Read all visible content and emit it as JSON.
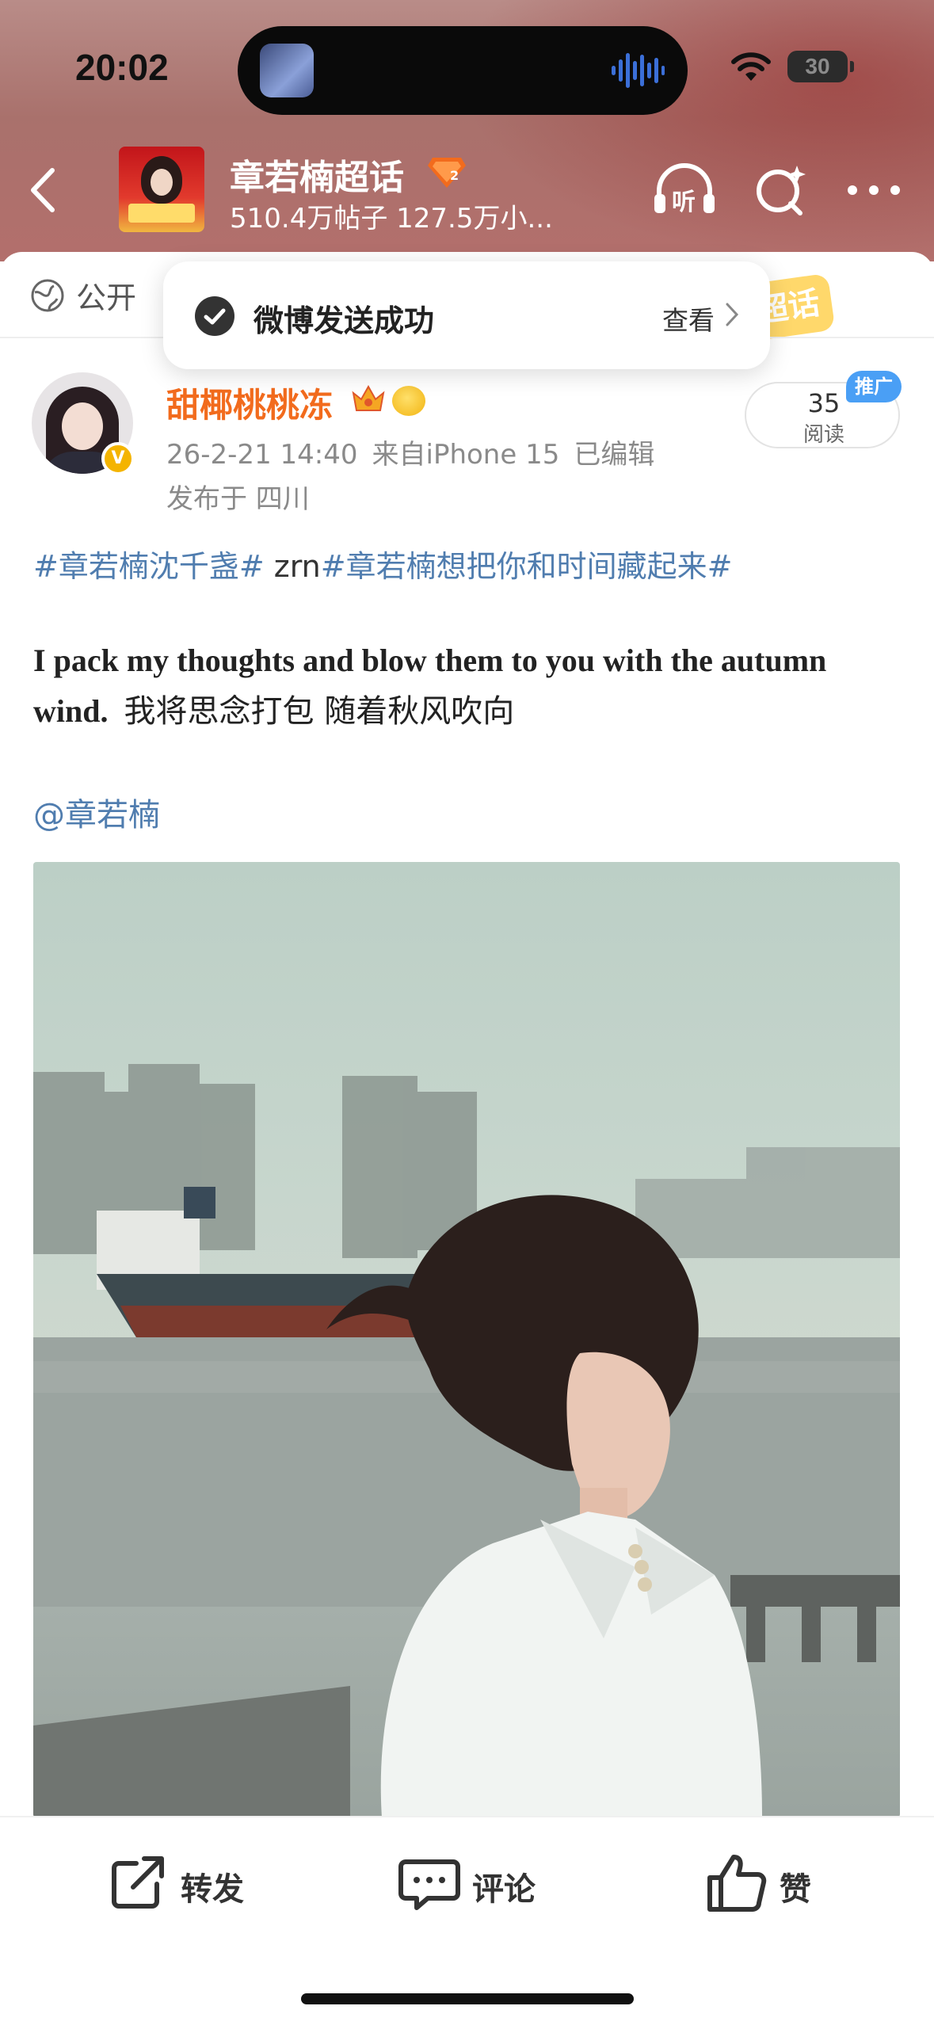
{
  "status_bar": {
    "time": "20:02",
    "battery": "30"
  },
  "header": {
    "back_icon": "chevron-left-icon",
    "topic_title": "章若楠超话",
    "topic_stats": "510.4万帖子 127.5万小...",
    "badge_icon": "diamond-level-icon",
    "listen_label": "听",
    "icons": [
      "listen-icon",
      "search-sparkle-icon",
      "more-icon"
    ]
  },
  "visibility": {
    "label": "公开",
    "sticker": "超话"
  },
  "toast": {
    "message": "微博发送成功",
    "action": "查看"
  },
  "post": {
    "author": "甜椰桃桃冻",
    "date": "26-2-21 14:40",
    "source": "来自iPhone 15",
    "edited": "已编辑",
    "location": "发布于 四川",
    "reads_count": "35",
    "reads_label": "阅读",
    "promo_label": "推广",
    "hashtag1": "#章若楠沈千盏#",
    "plain_text": " zrn",
    "hashtag2": "#章若楠想把你和时间藏起来#",
    "body_en": "I pack my thoughts and blow them to you with the autumn wind.",
    "body_cn": "我将思念打包 随着秋风吹向",
    "mention": "@章若楠"
  },
  "actions": {
    "repost": "转发",
    "comment": "评论",
    "like": "赞"
  },
  "colors": {
    "link_blue": "#507daf",
    "author_orange": "#f26b1d",
    "verified_gold": "#f4b400",
    "promo_blue": "#4a9ff5"
  }
}
